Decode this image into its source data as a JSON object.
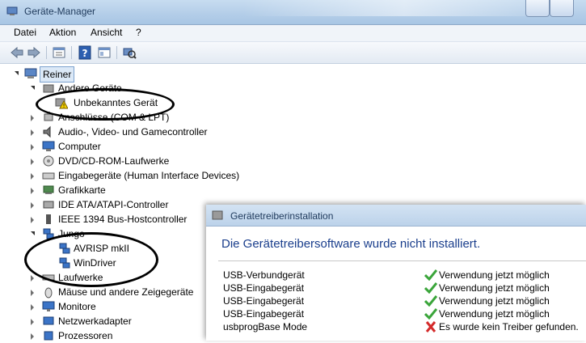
{
  "window": {
    "title": "Geräte-Manager"
  },
  "menu": {
    "file": "Datei",
    "action": "Aktion",
    "view": "Ansicht",
    "help": "?"
  },
  "tree": {
    "root": "Reiner",
    "items": [
      {
        "label": "Andere Geräte",
        "expanded": true
      },
      {
        "label": "Unbekanntes Gerät",
        "child": true
      },
      {
        "label": "Anschlüsse (COM & LPT)"
      },
      {
        "label": "Audio-, Video- und Gamecontroller"
      },
      {
        "label": "Computer"
      },
      {
        "label": "DVD/CD-ROM-Laufwerke"
      },
      {
        "label": "Eingabegeräte (Human Interface Devices)"
      },
      {
        "label": "Grafikkarte"
      },
      {
        "label": "IDE ATA/ATAPI-Controller"
      },
      {
        "label": "IEEE 1394 Bus-Hostcontroller"
      },
      {
        "label": "Jungo",
        "expanded": true
      },
      {
        "label": "AVRISP mkII",
        "child": true
      },
      {
        "label": "WinDriver",
        "child": true
      },
      {
        "label": "Laufwerke"
      },
      {
        "label": "Mäuse und andere Zeigegeräte"
      },
      {
        "label": "Monitore"
      },
      {
        "label": "Netzwerkadapter"
      },
      {
        "label": "Prozessoren"
      }
    ]
  },
  "dialog": {
    "title": "Gerätetreiberinstallation",
    "heading": "Die Gerätetreibersoftware wurde nicht installiert.",
    "rows": [
      {
        "device": "USB-Verbundgerät",
        "status": "Verwendung jetzt möglich",
        "ok": true
      },
      {
        "device": "USB-Eingabegerät",
        "status": "Verwendung jetzt möglich",
        "ok": true
      },
      {
        "device": "USB-Eingabegerät",
        "status": "Verwendung jetzt möglich",
        "ok": true
      },
      {
        "device": "USB-Eingabegerät",
        "status": "Verwendung jetzt möglich",
        "ok": true
      },
      {
        "device": "usbprogBase Mode",
        "status": "Es wurde kein Treiber gefunden.",
        "ok": false
      }
    ]
  },
  "colors": {
    "ok": "#3aa53a",
    "error": "#d42a2a",
    "heading": "#1a3e8c"
  }
}
